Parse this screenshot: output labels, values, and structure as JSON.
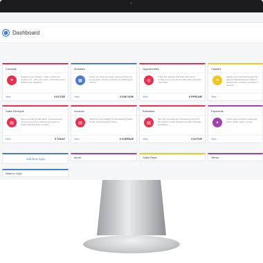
{
  "header": {
    "title": "Dashboard"
  },
  "cards": [
    {
      "title": "Contacts",
      "desc": "Organize your contacts - leads, customers, vendors, etc. - all in one place. You'll have every detail at your fingertips.",
      "view": "View",
      "stat": "6 ACTIVE",
      "accent": "#e8304e",
      "icon": "person-icon"
    },
    {
      "title": "Activities",
      "desc": "Track your customer history and log activity all in one place, and set reminders so nothing gets missed.",
      "view": "View",
      "stat": "5 DUE NOW",
      "accent": "#4a7ad1",
      "icon": "calendar-icon"
    },
    {
      "title": "Opportunities",
      "desc": "Track your pipeline and what each rep is working on so you can forecast sales and close more deals.",
      "view": "View",
      "stat": "6 PIPELINE",
      "accent": "#e8304e",
      "icon": "target-icon"
    },
    {
      "title": "Classes",
      "desc": "Allows you to track and assign fine-grained classifications to different departments, locations, products or services.",
      "view": "View",
      "stat": "",
      "accent": "#f4c51c",
      "icon": "tag-icon"
    },
    {
      "title": "Sales Receipts",
      "desc": "Save time and provide faster, comprehensive customer service by allowing your team to create and view sales receipts.",
      "view": "View",
      "stat": "6 TODAY",
      "accent": "#e8304e",
      "icon": "receipt-icon"
    },
    {
      "title": "Invoices",
      "desc": "Speed up your workflow by empowering staff to create, edit and send invoices.",
      "view": "View",
      "stat": "6 OVERDUE",
      "accent": "#e8304e",
      "icon": "invoice-icon"
    },
    {
      "title": "Estimates",
      "desc": "Win more business by empowering your front line staff to provide fast and accurate estimates and quotes.",
      "view": "View",
      "stat": "6 ACTIVE",
      "accent": "#e8304e",
      "icon": "estimate-icon"
    },
    {
      "title": "Payments",
      "desc": "Collect payments from customers online, faster, easier, secure.",
      "view": "View",
      "stat": "",
      "accent": "#a23fb0",
      "icon": "payment-icon"
    }
  ],
  "small_cards": [
    {
      "title": "Add More Apps",
      "link": true
    },
    {
      "title": "Items",
      "link": false
    },
    {
      "title": "Sales Reps",
      "link": false
    },
    {
      "title": "Terms",
      "link": false
    }
  ],
  "bottom_card": {
    "title": "Want to Lead"
  }
}
